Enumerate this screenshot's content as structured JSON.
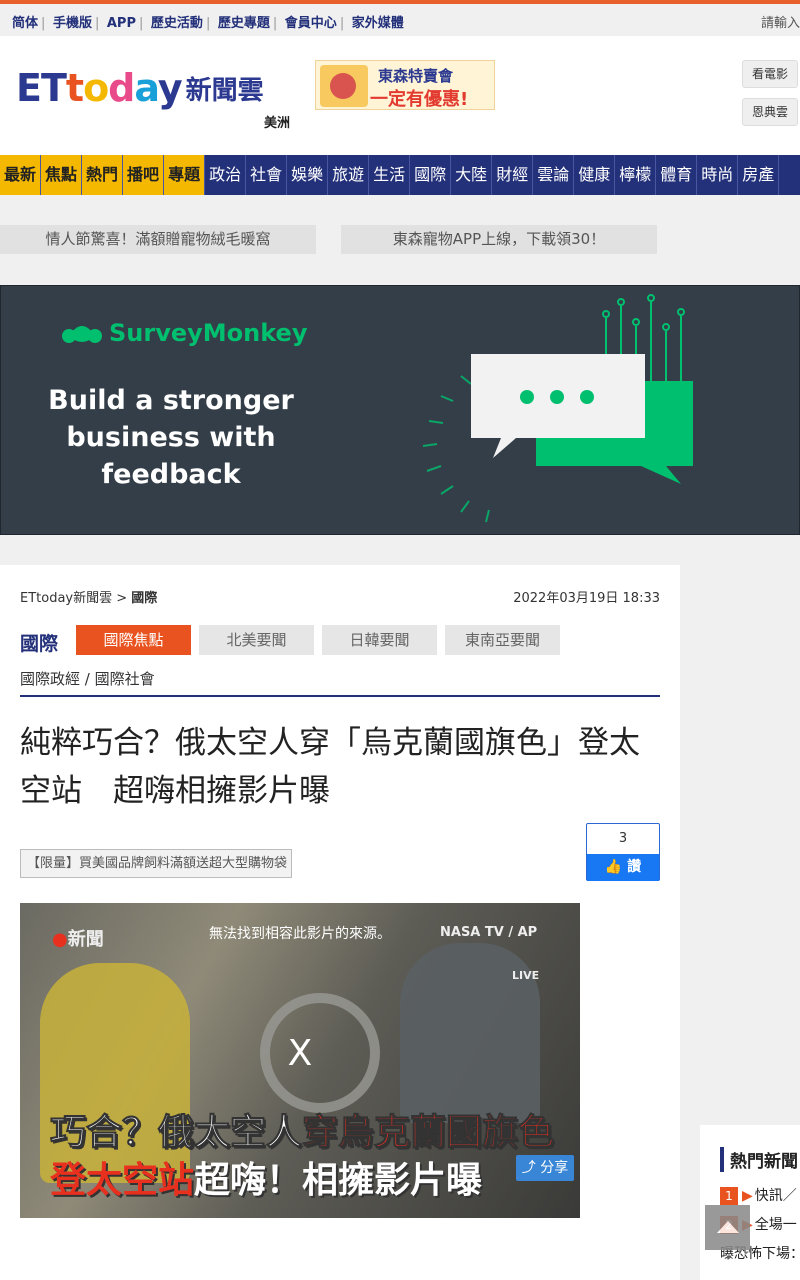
{
  "topbar": {
    "links": [
      "简体",
      "手機版",
      "APP",
      "歷史活動",
      "歷史專題",
      "會員中心",
      "家外媒體"
    ],
    "login": "請輸入"
  },
  "header": {
    "logo_latin": "ETtoday",
    "logo_cn": "新聞雲",
    "region": "美洲",
    "ad_line1": "東森特賣會",
    "ad_line2": "一定有優惠!",
    "btn_movie": "看電影",
    "btn_grace": "恩典雲"
  },
  "nav": {
    "items": [
      "最新",
      "焦點",
      "熱門",
      "播吧",
      "專題",
      "政治",
      "社會",
      "娛樂",
      "旅遊",
      "生活",
      "國際",
      "大陸",
      "財經",
      "雲論",
      "健康",
      "檸檬",
      "體育",
      "時尚",
      "房產"
    ]
  },
  "promos": [
    "情人節驚喜！滿額贈寵物絨毛暖窩",
    "東森寵物APP上線，下載領30！"
  ],
  "banner_ad": {
    "brand": "SurveyMonkey",
    "headline": "Build a stronger business with feedback",
    "brand_color": "#00bf6f"
  },
  "article": {
    "breadcrumb_home": "ETtoday新聞雲 >",
    "breadcrumb_section": "國際",
    "date": "2022年03月19日 18:33",
    "section_title": "國際",
    "tabs": [
      "國際焦點",
      "北美要聞",
      "日韓要聞",
      "東南亞要聞"
    ],
    "subcats": "國際政經 / 國際社會",
    "headline": "純粹巧合？俄太空人穿「烏克蘭國旗色」登太空站　超嗨相擁影片曝",
    "like_count": "3",
    "like_label": "讚",
    "promo_link": "【限量】買美國品牌飼料滿額送超大型購物袋"
  },
  "video": {
    "brand": "新聞",
    "credit": "NASA TV / AP",
    "live": "LIVE",
    "error": "無法找到相容此影片的來源。",
    "close": "X",
    "caption1_a": "巧合？俄太空人",
    "caption1_b": "穿烏克蘭國旗色",
    "caption2_a": "登太空站",
    "caption2_b": "超嗨！相擁影片曝",
    "share": "分享"
  },
  "sidebar": {
    "title": "熱門新聞",
    "items": [
      {
        "num": "1",
        "text": "快訊／"
      },
      {
        "num": "2",
        "text": "全場一"
      }
    ],
    "extra_line": "曝恐怖下場："
  },
  "colors": {
    "nav_bg": "#23307a",
    "nav_highlight": "#f5b800",
    "accent": "#e8531f"
  }
}
